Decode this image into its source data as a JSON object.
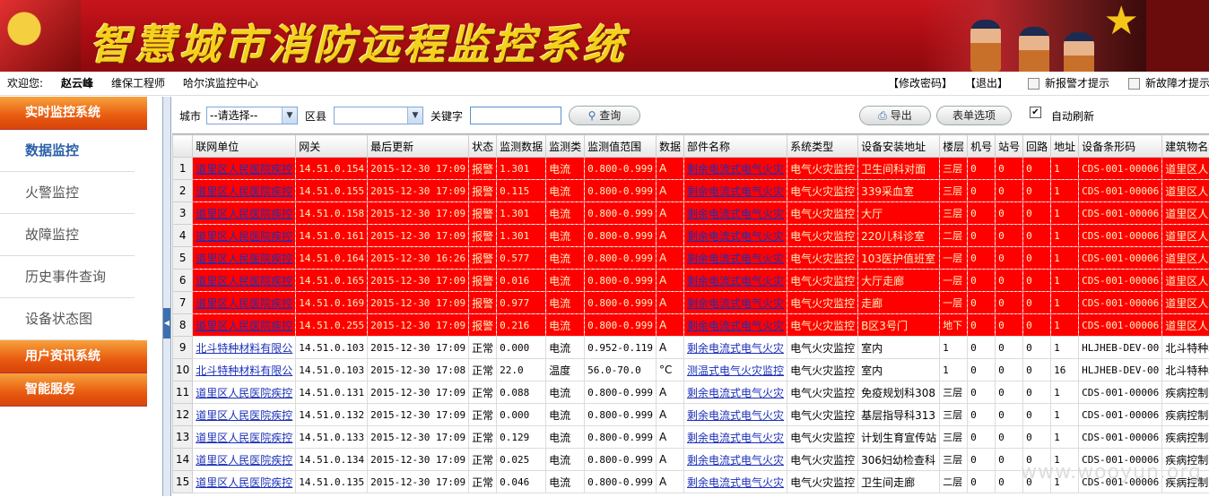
{
  "banner": {
    "title": "智慧城市消防远程监控系统"
  },
  "welcome": {
    "greet": "欢迎您:",
    "user": "赵云峰",
    "role": "维保工程师",
    "center": "哈尔滨监控中心",
    "change_pwd": "【修改密码】",
    "logout": "【退出】",
    "new_alarm": "新报警才提示",
    "new_fault": "新故障才提示"
  },
  "sidebar": {
    "sections": [
      {
        "label": "实时监控系统",
        "items": [
          "数据监控",
          "火警监控",
          "故障监控",
          "历史事件查询",
          "设备状态图"
        ]
      },
      {
        "label": "用户资讯系统",
        "items": []
      },
      {
        "label": "智能服务",
        "items": []
      }
    ]
  },
  "toolbar": {
    "city_label": "城市",
    "city_value": "--请选择--",
    "district_label": "区县",
    "district_value": "",
    "keyword_label": "关键字",
    "keyword_value": "",
    "search": "查询",
    "export": "导出",
    "columns": "表单选项",
    "auto_refresh": "自动刷新"
  },
  "table": {
    "headers": [
      "",
      "联网单位",
      "网关",
      "最后更新",
      "状态",
      "监测数据",
      "监测类",
      "监测值范围",
      "数据",
      "部件名称",
      "系统类型",
      "设备安装地址",
      "楼层",
      "机号",
      "站号",
      "回路",
      "地址",
      "设备条形码",
      "建筑物名称"
    ],
    "rows": [
      {
        "alarm": true,
        "cells": [
          "1",
          "道里区人民医院疾控",
          "14.51.0.154",
          "2015-12-30 17:09",
          "报警",
          "1.301",
          "电流",
          "0.800-0.999",
          "A",
          "剩余电流式电气火灾",
          "电气火灾监控",
          "卫生间科对面",
          "三层",
          "0",
          "0",
          "0",
          "1",
          "CDS-001-00006",
          "道里区人民医院"
        ]
      },
      {
        "alarm": true,
        "cells": [
          "2",
          "道里区人民医院疾控",
          "14.51.0.155",
          "2015-12-30 17:09",
          "报警",
          "0.115",
          "电流",
          "0.800-0.999",
          "A",
          "剩余电流式电气火灾",
          "电气火灾监控",
          "339采血室",
          "三层",
          "0",
          "0",
          "0",
          "1",
          "CDS-001-00006",
          "道里区人民医院"
        ]
      },
      {
        "alarm": true,
        "cells": [
          "3",
          "道里区人民医院疾控",
          "14.51.0.158",
          "2015-12-30 17:09",
          "报警",
          "1.301",
          "电流",
          "0.800-0.999",
          "A",
          "剩余电流式电气火灾",
          "电气火灾监控",
          "大厅",
          "三层",
          "0",
          "0",
          "0",
          "1",
          "CDS-001-00006",
          "道里区人民医院"
        ]
      },
      {
        "alarm": true,
        "cells": [
          "4",
          "道里区人民医院疾控",
          "14.51.0.161",
          "2015-12-30 17:09",
          "报警",
          "1.301",
          "电流",
          "0.800-0.999",
          "A",
          "剩余电流式电气火灾",
          "电气火灾监控",
          "220儿科诊室",
          "二层",
          "0",
          "0",
          "0",
          "1",
          "CDS-001-00006",
          "道里区人民医院"
        ]
      },
      {
        "alarm": true,
        "cells": [
          "5",
          "道里区人民医院疾控",
          "14.51.0.164",
          "2015-12-30 16:26",
          "报警",
          "0.577",
          "电流",
          "0.800-0.999",
          "A",
          "剩余电流式电气火灾",
          "电气火灾监控",
          "103医护值班室",
          "一层",
          "0",
          "0",
          "0",
          "1",
          "CDS-001-00006",
          "道里区人民医院"
        ]
      },
      {
        "alarm": true,
        "cells": [
          "6",
          "道里区人民医院疾控",
          "14.51.0.165",
          "2015-12-30 17:09",
          "报警",
          "0.016",
          "电流",
          "0.800-0.999",
          "A",
          "剩余电流式电气火灾",
          "电气火灾监控",
          "大厅走廊",
          "一层",
          "0",
          "0",
          "0",
          "1",
          "CDS-001-00006",
          "道里区人民医院"
        ]
      },
      {
        "alarm": true,
        "cells": [
          "7",
          "道里区人民医院疾控",
          "14.51.0.169",
          "2015-12-30 17:09",
          "报警",
          "0.977",
          "电流",
          "0.800-0.999",
          "A",
          "剩余电流式电气火灾",
          "电气火灾监控",
          "走廊",
          "一层",
          "0",
          "0",
          "0",
          "1",
          "CDS-001-00006",
          "道里区人民医院"
        ]
      },
      {
        "alarm": true,
        "cells": [
          "8",
          "道里区人民医院疾控",
          "14.51.0.255",
          "2015-12-30 17:09",
          "报警",
          "0.216",
          "电流",
          "0.800-0.999",
          "A",
          "剩余电流式电气火灾",
          "电气火灾监控",
          "B区3号门",
          "地下",
          "0",
          "0",
          "0",
          "1",
          "CDS-001-00006",
          "道里区人民医院"
        ]
      },
      {
        "alarm": false,
        "cells": [
          "9",
          "北斗特种材料有限公",
          "14.51.0.103",
          "2015-12-30 17:09",
          "正常",
          "0.000",
          "电流",
          "0.952-0.119",
          "A",
          "剩余电流式电气火灾",
          "电气火灾监控",
          "室内",
          "1",
          "0",
          "0",
          "0",
          "1",
          "HLJHEB-DEV-00",
          "北斗特种材料"
        ]
      },
      {
        "alarm": false,
        "cells": [
          "10",
          "北斗特种材料有限公",
          "14.51.0.103",
          "2015-12-30 17:08",
          "正常",
          "22.0",
          "温度",
          "56.0-70.0",
          "°C",
          "测温式电气火灾监控",
          "电气火灾监控",
          "室内",
          "1",
          "0",
          "0",
          "0",
          "16",
          "HLJHEB-DEV-00",
          "北斗特种材料"
        ]
      },
      {
        "alarm": false,
        "cells": [
          "11",
          "道里区人民医院疾控",
          "14.51.0.131",
          "2015-12-30 17:09",
          "正常",
          "0.088",
          "电流",
          "0.800-0.999",
          "A",
          "剩余电流式电气火灾",
          "电气火灾监控",
          "免疫规划科308",
          "三层",
          "0",
          "0",
          "0",
          "1",
          "CDS-001-00006",
          "疾病控制中心、妇"
        ]
      },
      {
        "alarm": false,
        "cells": [
          "12",
          "道里区人民医院疾控",
          "14.51.0.132",
          "2015-12-30 17:09",
          "正常",
          "0.000",
          "电流",
          "0.800-0.999",
          "A",
          "剩余电流式电气火灾",
          "电气火灾监控",
          "基层指导科313",
          "三层",
          "0",
          "0",
          "0",
          "1",
          "CDS-001-00006",
          "疾病控制中心、妇"
        ]
      },
      {
        "alarm": false,
        "cells": [
          "13",
          "道里区人民医院疾控",
          "14.51.0.133",
          "2015-12-30 17:09",
          "正常",
          "0.129",
          "电流",
          "0.800-0.999",
          "A",
          "剩余电流式电气火灾",
          "电气火灾监控",
          "计划生育宣传站",
          "三层",
          "0",
          "0",
          "0",
          "1",
          "CDS-001-00006",
          "疾病控制中心、妇"
        ]
      },
      {
        "alarm": false,
        "cells": [
          "14",
          "道里区人民医院疾控",
          "14.51.0.134",
          "2015-12-30 17:09",
          "正常",
          "0.025",
          "电流",
          "0.800-0.999",
          "A",
          "剩余电流式电气火灾",
          "电气火灾监控",
          "306妇幼检查科",
          "三层",
          "0",
          "0",
          "0",
          "1",
          "CDS-001-00006",
          "疾病控制中心、妇"
        ]
      },
      {
        "alarm": false,
        "cells": [
          "15",
          "道里区人民医院疾控",
          "14.51.0.135",
          "2015-12-30 17:09",
          "正常",
          "0.046",
          "电流",
          "0.800-0.999",
          "A",
          "剩余电流式电气火灾",
          "电气火灾监控",
          "卫生间走廊",
          "二层",
          "0",
          "0",
          "0",
          "1",
          "CDS-001-00006",
          "疾病控制中心、妇"
        ]
      }
    ]
  },
  "watermark": "www.wooyun.org",
  "colors": {
    "alarm_row": "#ff0000",
    "nav_section": "#e85a10",
    "link": "#1a2fb8"
  }
}
